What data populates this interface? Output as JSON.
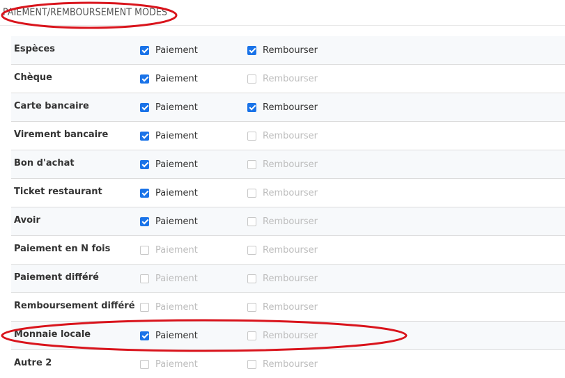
{
  "section": {
    "title": "PAIEMENT/REMBOURSEMENT MODES"
  },
  "option_labels": {
    "payment": "Paiement",
    "refund": "Rembourser"
  },
  "rows": [
    {
      "label": "Espèces",
      "payment": true,
      "refund": true
    },
    {
      "label": "Chèque",
      "payment": true,
      "refund": false
    },
    {
      "label": "Carte bancaire",
      "payment": true,
      "refund": true
    },
    {
      "label": "Virement bancaire",
      "payment": true,
      "refund": false
    },
    {
      "label": "Bon d'achat",
      "payment": true,
      "refund": false
    },
    {
      "label": "Ticket restaurant",
      "payment": true,
      "refund": false
    },
    {
      "label": "Avoir",
      "payment": true,
      "refund": false
    },
    {
      "label": "Paiement en N fois",
      "payment": false,
      "refund": false
    },
    {
      "label": "Paiement différé",
      "payment": false,
      "refund": false
    },
    {
      "label": "Remboursement différé",
      "payment": false,
      "refund": false
    },
    {
      "label": "Monnaie locale",
      "payment": true,
      "refund": false
    },
    {
      "label": "Autre 2",
      "payment": false,
      "refund": false
    }
  ],
  "colors": {
    "accent": "#1a73e8",
    "annotation": "#d9141c"
  }
}
